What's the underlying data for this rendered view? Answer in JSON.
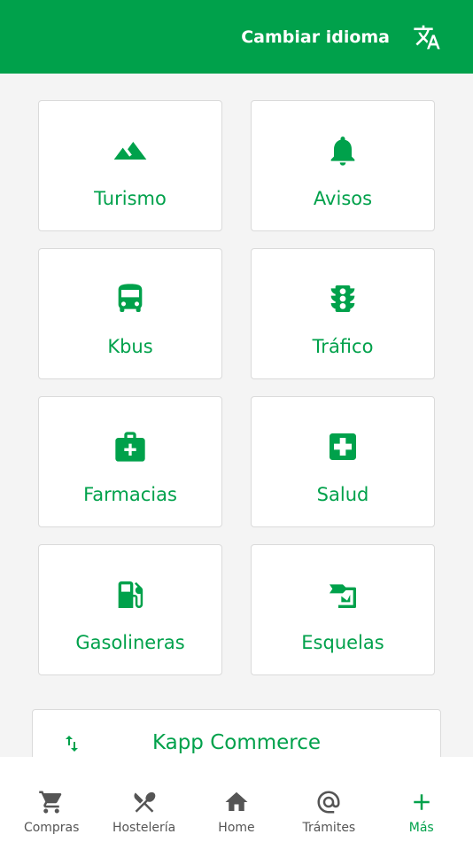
{
  "colors": {
    "brand": "#00a14b",
    "nav_inactive": "#555555",
    "background": "#f4f4f4"
  },
  "header": {
    "language_label": "Cambiar idioma",
    "language_icon": "translate-icon"
  },
  "tiles": [
    {
      "label": "Turismo",
      "icon": "mountain-icon"
    },
    {
      "label": "Avisos",
      "icon": "bell-icon"
    },
    {
      "label": "Kbus",
      "icon": "bus-icon"
    },
    {
      "label": "Tráfico",
      "icon": "traffic-light-icon"
    },
    {
      "label": "Farmacias",
      "icon": "medical-bag-icon"
    },
    {
      "label": "Salud",
      "icon": "hospital-cross-icon"
    },
    {
      "label": "Gasolineras",
      "icon": "gas-station-icon"
    },
    {
      "label": "Esquelas",
      "icon": "obituary-icon"
    }
  ],
  "commerce": {
    "label": "Kapp Commerce",
    "icon": "swap-vertical-icon"
  },
  "bottom_nav": [
    {
      "label": "Compras",
      "icon": "cart-icon"
    },
    {
      "label": "Hostelería",
      "icon": "silverware-icon"
    },
    {
      "label": "Home",
      "icon": "home-icon"
    },
    {
      "label": "Trámites",
      "icon": "at-icon"
    },
    {
      "label": "Más",
      "icon": "plus-icon",
      "active": true
    }
  ]
}
